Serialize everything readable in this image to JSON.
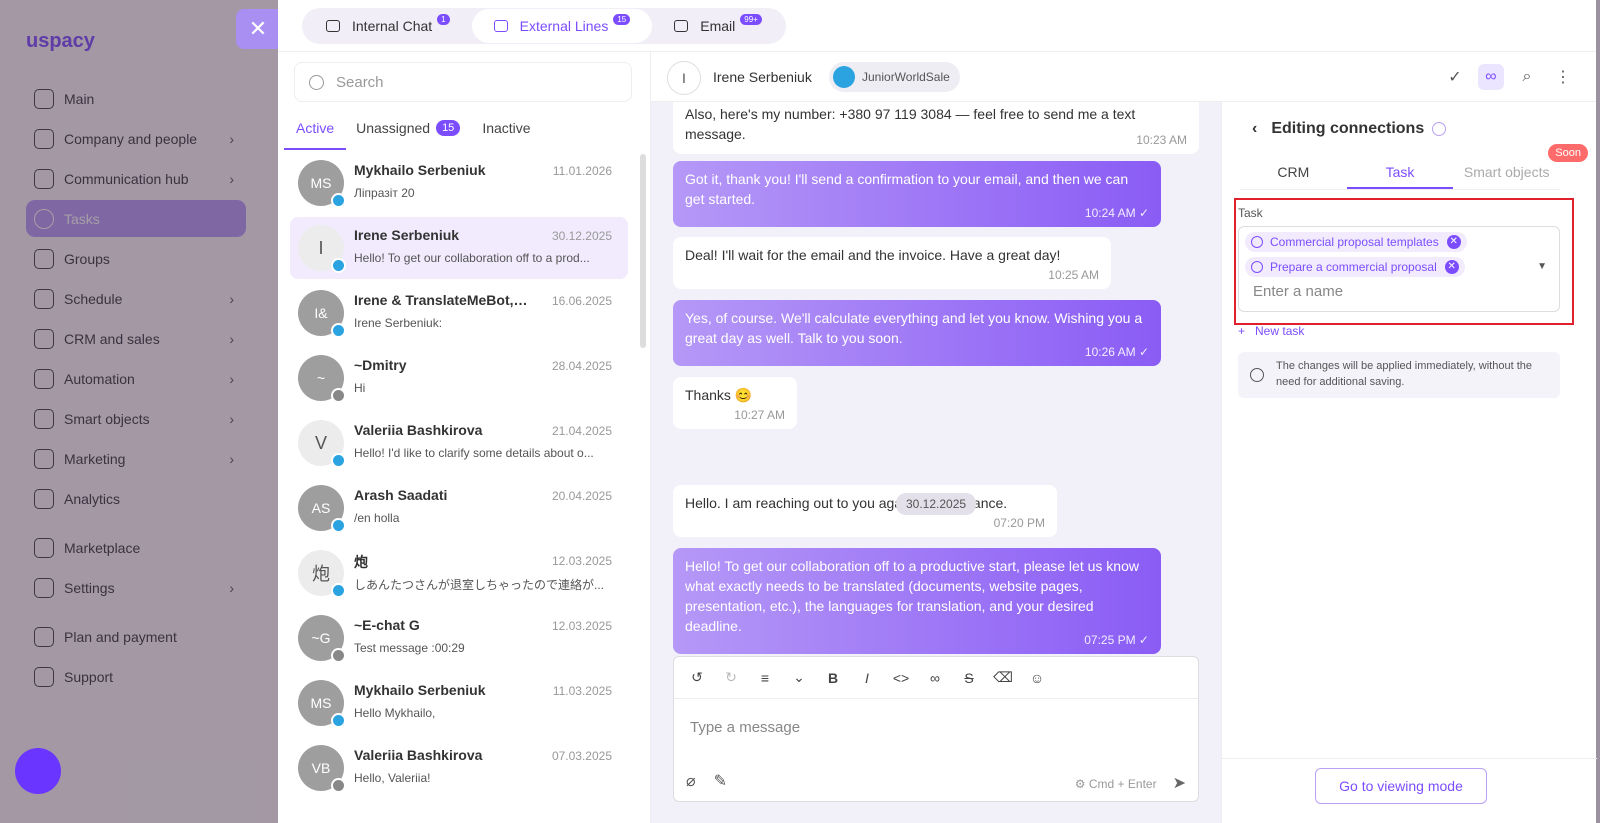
{
  "app": {
    "logo": "uspacy"
  },
  "sidebar": {
    "items": [
      {
        "label": "Main"
      },
      {
        "label": "Company and people",
        "chev": "›"
      },
      {
        "label": "Communication hub",
        "chev": "›"
      },
      {
        "label": "Tasks"
      },
      {
        "label": "Groups"
      },
      {
        "label": "Schedule",
        "chev": "›"
      },
      {
        "label": "CRM and sales",
        "chev": "›"
      },
      {
        "label": "Automation",
        "chev": "›"
      },
      {
        "label": "Smart objects",
        "chev": "›"
      },
      {
        "label": "Marketing",
        "chev": "›"
      },
      {
        "label": "Analytics"
      },
      {
        "label": "Marketplace"
      },
      {
        "label": "Settings",
        "chev": "›"
      },
      {
        "label": "Plan and payment"
      },
      {
        "label": "Support"
      }
    ]
  },
  "tabs": [
    {
      "label": "Internal Chat",
      "count": "1"
    },
    {
      "label": "External Lines",
      "count": "15"
    },
    {
      "label": "Email",
      "count": "99+"
    }
  ],
  "search": {
    "placeholder": "Search"
  },
  "subtabs": {
    "active": "Active",
    "unassigned": "Unassigned",
    "unassigned_count": "15",
    "inactive": "Inactive"
  },
  "chats": [
    {
      "initials": "MS",
      "name": "Mykhailo Serbeniuk",
      "date": "11.01.2026",
      "preview": "Ліпразіт 20"
    },
    {
      "initials": "I",
      "name": "Irene Serbeniuk",
      "date": "30.12.2025",
      "preview": "Hello! To get our collaboration off to a prod..."
    },
    {
      "initials": "I&",
      "name": "Irene & TranslateMeBot, ...",
      "date": "16.06.2025",
      "preview": "Irene Serbeniuk:"
    },
    {
      "initials": "~",
      "name": "~Dmitry",
      "date": "28.04.2025",
      "preview": "Hi"
    },
    {
      "initials": "V",
      "name": "Valeriia Bashkirova",
      "date": "21.04.2025",
      "preview": "Hello! I'd like to clarify some details about o..."
    },
    {
      "initials": "AS",
      "name": "Arash Saadati",
      "date": "20.04.2025",
      "preview": "/en holla"
    },
    {
      "initials": "炮",
      "name": "炮",
      "date": "12.03.2025",
      "preview": "しあんたつさんが退室しちゃったので連絡が..."
    },
    {
      "initials": "~G",
      "name": "~E-chat G",
      "date": "12.03.2025",
      "preview": "Test message :00:29"
    },
    {
      "initials": "MS",
      "name": "Mykhailo Serbeniuk",
      "date": "11.03.2025",
      "preview": "Hello Mykhailo,"
    },
    {
      "initials": "VB",
      "name": "Valeriia Bashkirova",
      "date": "07.03.2025",
      "preview": "Hello, Valeriia!"
    }
  ],
  "header": {
    "initial": "I",
    "name": "Irene Serbeniuk",
    "channel": "JuniorWorldSale"
  },
  "messages": [
    {
      "text": "Also, here's my number: +380 97 119 3084 — feel free to send me a text message.",
      "time": "10:23 AM"
    },
    {
      "text": "Got it, thank you! I'll send a confirmation to your email, and then we can get started.",
      "time": "10:24 AM ✓"
    },
    {
      "text": "Deal! I'll wait for the email and the invoice. Have a great day!",
      "time": "10:25 AM"
    },
    {
      "text": "Yes, of course. We'll calculate everything and let you know. Wishing you a great day as well. Talk to you soon.",
      "time": "10:26 AM ✓"
    },
    {
      "text": "Thanks 😊",
      "time": "10:27 AM"
    },
    {
      "text": "Hello. I am reaching out to you again for assistance.",
      "time": "07:20 PM"
    },
    {
      "text": "Hello! To get our collaboration off to a productive start, please let us know what exactly needs to be translated (documents, website pages, presentation, etc.), the languages for translation, and your desired deadline.",
      "time": "07:25 PM ✓"
    }
  ],
  "date_divider": "30.12.2025",
  "composer": {
    "placeholder": "Type a message",
    "shortcut": "Cmd + Enter"
  },
  "right": {
    "title": "Editing connections",
    "tabs": [
      "CRM",
      "Task",
      "Smart objects"
    ],
    "soon": "Soon",
    "task_label": "Task",
    "chips": [
      "Commercial proposal templates",
      "Prepare a commercial proposal"
    ],
    "name_placeholder": "Enter a name",
    "new_task": "New task",
    "info": "The changes will be applied immediately, without the need for additional saving.",
    "view_button": "Go to viewing mode"
  }
}
